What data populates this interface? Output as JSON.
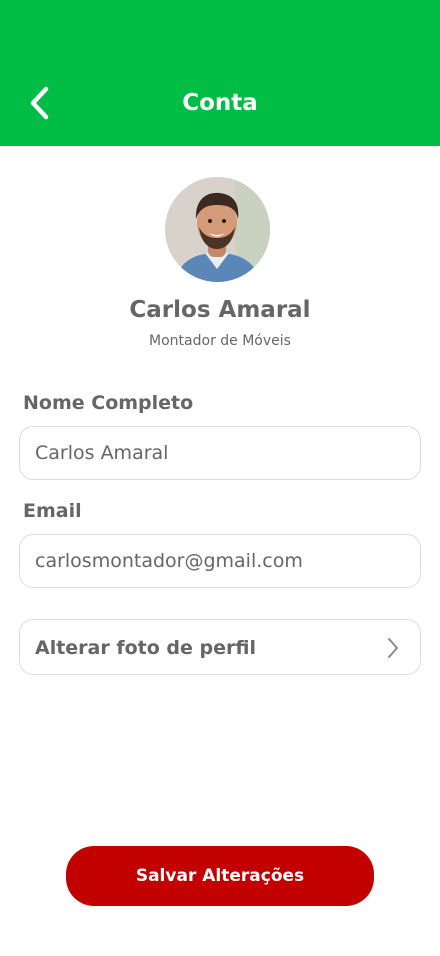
{
  "header": {
    "title": "Conta",
    "background_color": "#00BD45",
    "back_icon": "chevron-left-icon"
  },
  "profile": {
    "name": "Carlos Amaral",
    "role": "Montador de Móveis"
  },
  "form": {
    "full_name_label": "Nome Completo",
    "full_name_value": "Carlos Amaral",
    "email_label": "Email",
    "email_value": "carlosmontador@gmail.com"
  },
  "actions": {
    "change_photo_label": "Alterar foto de perfil",
    "change_photo_icon": "chevron-right-icon"
  },
  "footer": {
    "save_label": "Salvar Alterações",
    "save_color": "#C30000"
  }
}
